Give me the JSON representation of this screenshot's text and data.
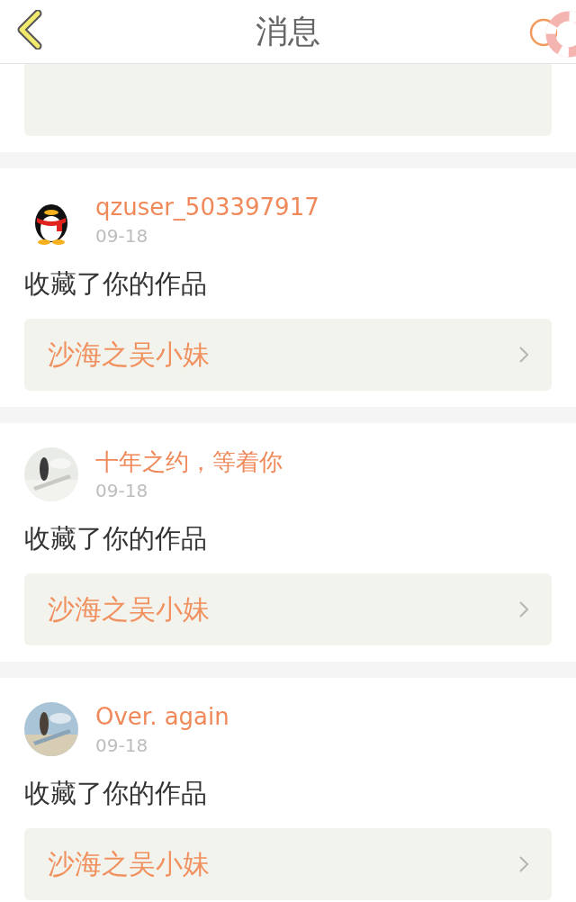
{
  "header": {
    "title": "消息"
  },
  "messages": [
    {
      "avatar": {
        "kind": "penguin"
      },
      "name": "qzuser_503397917",
      "date": "09-18",
      "action": "收藏了你的作品",
      "work": "沙海之吴小妹"
    },
    {
      "name": "十年之约，等着你",
      "date": "09-18",
      "action": "收藏了你的作品",
      "work": "沙海之吴小妹"
    },
    {
      "name": "Over. again",
      "date": "09-18",
      "action": "收藏了你的作品",
      "work": "沙海之吴小妹"
    }
  ]
}
